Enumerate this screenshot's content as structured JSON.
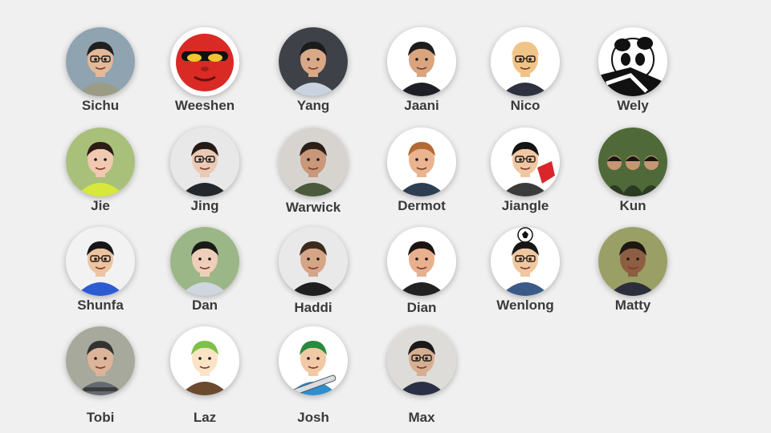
{
  "members": [
    {
      "name": "Sichu",
      "avatar": "photo-portrait-icon",
      "bg": "#8fa3b0",
      "skin": "#e3b999",
      "hair": "#1f1f1f",
      "shirt": "#9c9c86",
      "glasses": true
    },
    {
      "name": "Weeshen",
      "avatar": "red-demon-cartoon-icon",
      "bg": "#ffffff",
      "skin": "#d92a25",
      "hair": "#000000",
      "shirt": "#111111",
      "glasses": false
    },
    {
      "name": "Yang",
      "avatar": "photo-portrait-icon",
      "bg": "#3e4248",
      "skin": "#d9a887",
      "hair": "#1b1b1b",
      "shirt": "#c9d3df",
      "glasses": false
    },
    {
      "name": "Jaani",
      "avatar": "cartoon-suit-icon",
      "bg": "#ffffff",
      "skin": "#d9a57f",
      "hair": "#1d1d1d",
      "shirt": "#1e1e26",
      "glasses": false
    },
    {
      "name": "Nico",
      "avatar": "cartoon-avatar-icon",
      "bg": "#ffffff",
      "skin": "#f0c387",
      "hair": "#f0c387",
      "shirt": "#2d3140",
      "glasses": true
    },
    {
      "name": "Wely",
      "avatar": "panda-icon",
      "bg": "#ffffff",
      "skin": "#ffffff",
      "hair": "#111111",
      "shirt": "#111111",
      "glasses": false
    },
    {
      "name": "Jie",
      "avatar": "photo-portrait-icon",
      "bg": "#a8c07a",
      "skin": "#f0c9b0",
      "hair": "#2b1d15",
      "shirt": "#d8e83a",
      "glasses": false
    },
    {
      "name": "Jing",
      "avatar": "photo-portrait-icon",
      "bg": "#e8e8e8",
      "skin": "#eac9b5",
      "hair": "#241a16",
      "shirt": "#23272b",
      "glasses": true
    },
    {
      "name": "Warwick",
      "avatar": "photo-portrait-icon",
      "bg": "#d7d4cf",
      "skin": "#c9977a",
      "hair": "#2a2018",
      "shirt": "#4b5a3d",
      "glasses": false
    },
    {
      "name": "Dermot",
      "avatar": "cartoon-avatar-icon",
      "bg": "#ffffff",
      "skin": "#e9b48f",
      "hair": "#b46a34",
      "shirt": "#2f3d52",
      "glasses": false
    },
    {
      "name": "Jiangle",
      "avatar": "cartoon-glove-icon",
      "bg": "#ffffff",
      "skin": "#f1c7a2",
      "hair": "#141414",
      "shirt": "#3b3b3b",
      "glasses": true
    },
    {
      "name": "Kun",
      "avatar": "photo-group-icon",
      "bg": "#4f6a38",
      "skin": "#c59672",
      "hair": "#151515",
      "shirt": "#2c3a24",
      "glasses": true
    },
    {
      "name": "Shunfa",
      "avatar": "photo-portrait-icon",
      "bg": "#f2f2f2",
      "skin": "#eec3a0",
      "hair": "#161616",
      "shirt": "#2d5bd1",
      "glasses": true
    },
    {
      "name": "Dan",
      "avatar": "photo-portrait-icon",
      "bg": "#9bb687",
      "skin": "#efcfb9",
      "hair": "#1a1a1a",
      "shirt": "#cfd6df",
      "glasses": false
    },
    {
      "name": "Haddi",
      "avatar": "photo-portrait-icon",
      "bg": "#e9e9e9",
      "skin": "#d5a587",
      "hair": "#3b2a1e",
      "shirt": "#1f1f1f",
      "glasses": false
    },
    {
      "name": "Dian",
      "avatar": "cartoon-avatar-icon",
      "bg": "#ffffff",
      "skin": "#e9b08e",
      "hair": "#1b1412",
      "shirt": "#222222",
      "glasses": false
    },
    {
      "name": "Wenlong",
      "avatar": "cartoon-soccer-icon",
      "bg": "#ffffff",
      "skin": "#f1c79f",
      "hair": "#161616",
      "shirt": "#3c5a87",
      "glasses": true
    },
    {
      "name": "Matty",
      "avatar": "photo-portrait-icon",
      "bg": "#9aa065",
      "skin": "#8d5e42",
      "hair": "#1f1712",
      "shirt": "#2c2f3b",
      "glasses": false
    },
    {
      "name": "Tobi",
      "avatar": "photo-skater-icon",
      "bg": "#a7a99d",
      "skin": "#dcb49a",
      "hair": "#333333",
      "shirt": "#646a70",
      "glasses": false
    },
    {
      "name": "Laz",
      "avatar": "cartoon-bearded-icon",
      "bg": "#ffffff",
      "skin": "#fbe3c6",
      "hair": "#7ec146",
      "shirt": "#6b4a2e",
      "glasses": false
    },
    {
      "name": "Josh",
      "avatar": "cartoon-snowboard-icon",
      "bg": "#ffffff",
      "skin": "#f1c9a5",
      "hair": "#2a8a3c",
      "shirt": "#2f8fcf",
      "glasses": false
    },
    {
      "name": "Max",
      "avatar": "photo-portrait-icon",
      "bg": "#dedcd8",
      "skin": "#d8ae92",
      "hair": "#1a1a1a",
      "shirt": "#2a2f45",
      "glasses": true
    }
  ]
}
